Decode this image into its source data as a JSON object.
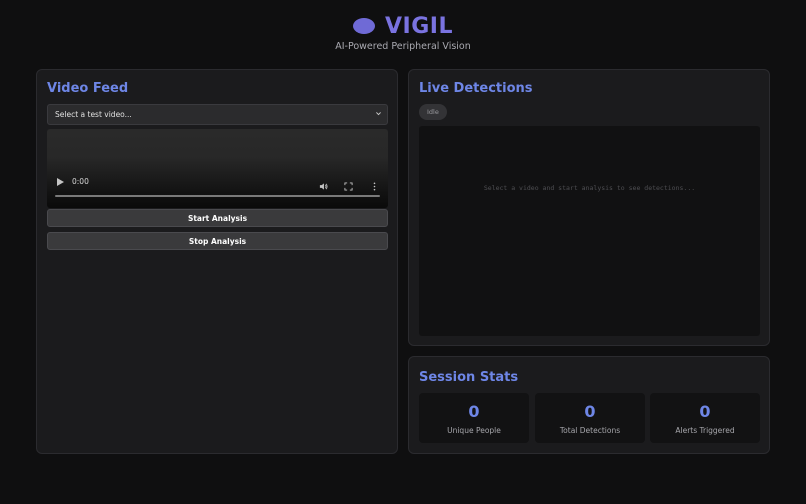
{
  "header": {
    "logo_icon": "eye-icon",
    "title": "VIGIL",
    "subtitle": "AI-Powered Peripheral Vision",
    "accent_color": "#7a73e0"
  },
  "video_panel": {
    "title": "Video Feed",
    "select": {
      "selected": "Select a test video...",
      "icon": "chevron-down-icon"
    },
    "player": {
      "time": "0:00",
      "icons": [
        "play-icon",
        "volume-icon",
        "fullscreen-icon",
        "more-icon"
      ]
    },
    "start_label": "Start Analysis",
    "stop_label": "Stop Analysis"
  },
  "detections_panel": {
    "title": "Live Detections",
    "status": "Idle",
    "empty_message": "Select a video and start analysis to see detections..."
  },
  "stats_panel": {
    "title": "Session Stats",
    "stats": [
      {
        "value": "0",
        "label": "Unique People"
      },
      {
        "value": "0",
        "label": "Total Detections"
      },
      {
        "value": "0",
        "label": "Alerts Triggered"
      }
    ],
    "accent_color": "#6e86e6"
  }
}
